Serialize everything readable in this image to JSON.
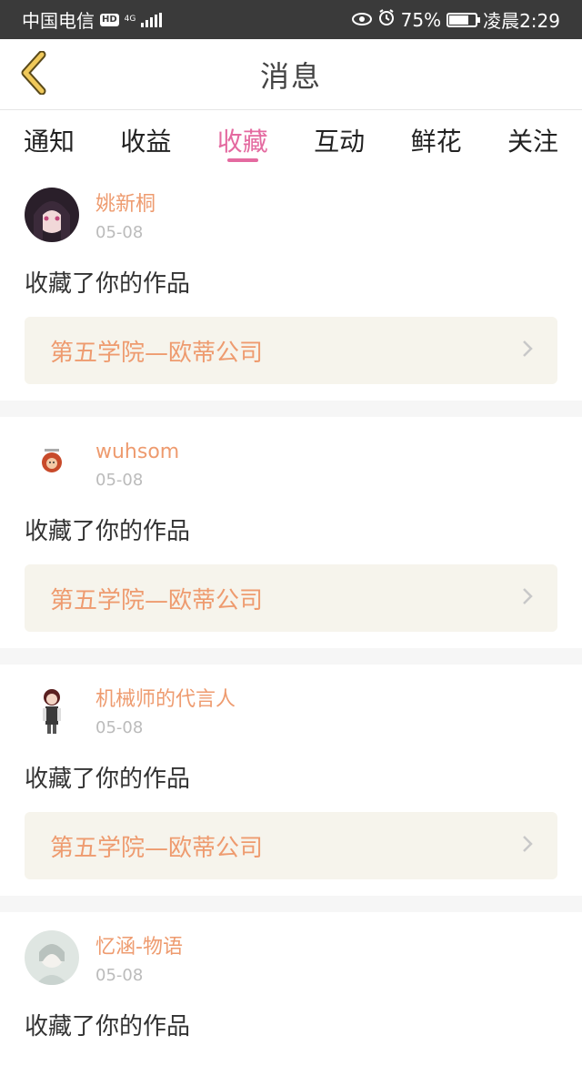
{
  "statusbar": {
    "carrier": "中国电信",
    "hd": "HD",
    "network": "4G",
    "battery_percent": "75%",
    "battery_level": 0.75,
    "time": "凌晨2:29"
  },
  "navbar": {
    "title": "消息"
  },
  "tabs": [
    {
      "label": "通知",
      "active": false
    },
    {
      "label": "收益",
      "active": false
    },
    {
      "label": "收藏",
      "active": true
    },
    {
      "label": "互动",
      "active": false
    },
    {
      "label": "鲜花",
      "active": false
    },
    {
      "label": "关注",
      "active": false
    }
  ],
  "feed": [
    {
      "username": "姚新桐",
      "date": "05-08",
      "action": "收藏了你的作品",
      "work": "第五学院—欧蒂公司"
    },
    {
      "username": "wuhsom",
      "date": "05-08",
      "action": "收藏了你的作品",
      "work": "第五学院—欧蒂公司"
    },
    {
      "username": "机械师的代言人",
      "date": "05-08",
      "action": "收藏了你的作品",
      "work": "第五学院—欧蒂公司"
    },
    {
      "username": "忆涵-物语",
      "date": "05-08",
      "action": "收藏了你的作品",
      "work": ""
    }
  ],
  "colors": {
    "accent_pink": "#e46aa0",
    "username_orange": "#ee9b6f",
    "statusbar": "#3a3a3a",
    "work_bg": "#f6f4ec"
  }
}
